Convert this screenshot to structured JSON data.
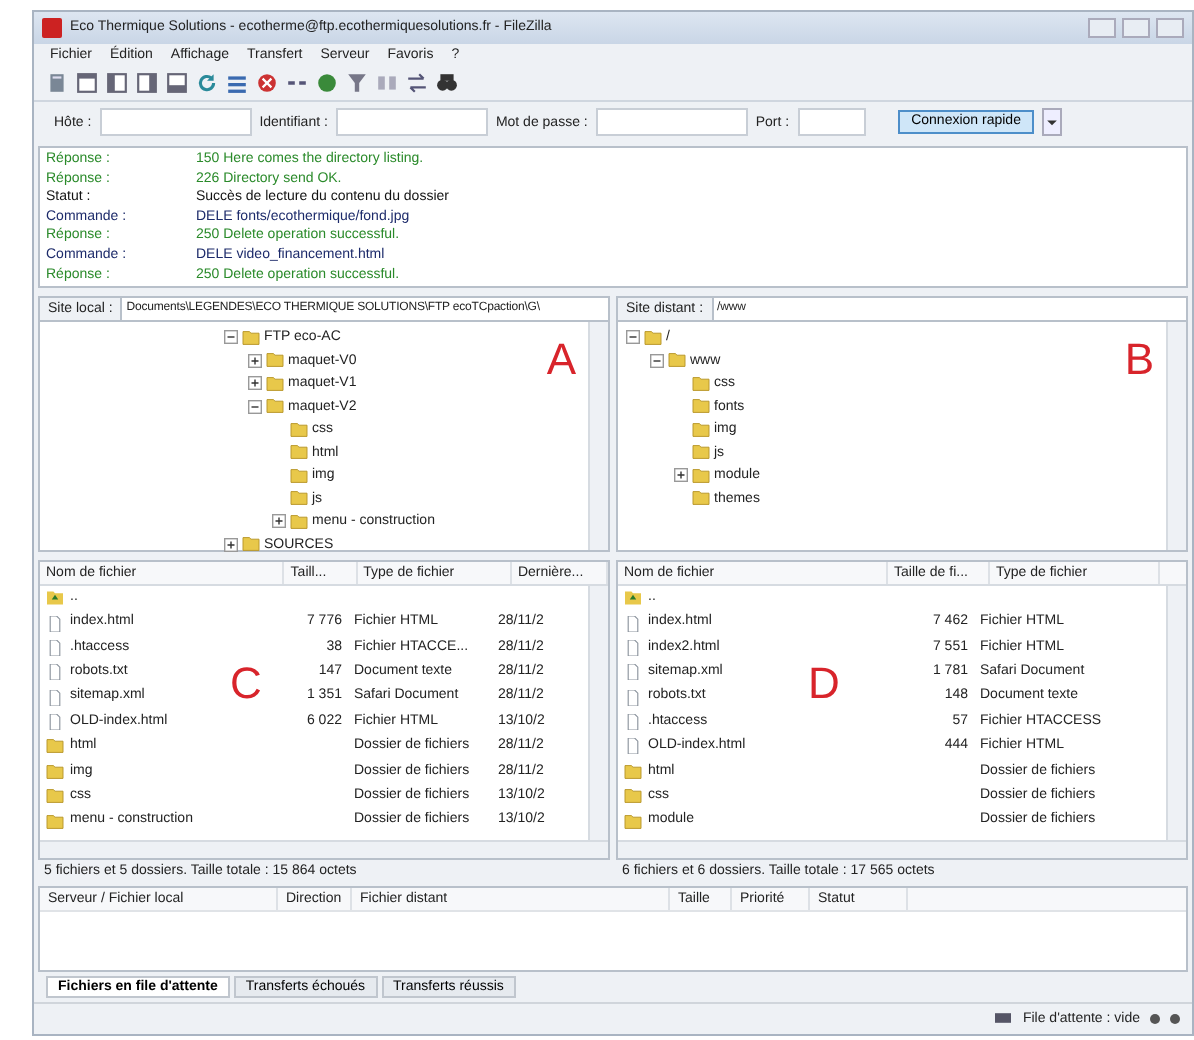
{
  "window": {
    "title": "Eco Thermique Solutions - ecotherme@ftp.ecothermiquesolutions.fr - FileZilla"
  },
  "menu": [
    "Fichier",
    "Édition",
    "Affichage",
    "Transfert",
    "Serveur",
    "Favoris",
    "?"
  ],
  "quickconnect": {
    "fields": [
      {
        "label": "Hôte :"
      },
      {
        "label": "Identifiant :"
      },
      {
        "label": "Mot de passe :"
      },
      {
        "label": "Port :"
      }
    ],
    "button": "Connexion rapide"
  },
  "log": [
    {
      "kind": "reponse",
      "label": "Réponse :",
      "text": "150 Here comes the directory listing."
    },
    {
      "kind": "reponse",
      "label": "Réponse :",
      "text": "226 Directory send OK."
    },
    {
      "kind": "statut",
      "label": "Statut :",
      "text": "Succès de lecture du contenu du dossier"
    },
    {
      "kind": "commande",
      "label": "Commande :",
      "text": "DELE fonts/ecothermique/fond.jpg"
    },
    {
      "kind": "reponse",
      "label": "Réponse :",
      "text": "250 Delete operation successful."
    },
    {
      "kind": "commande",
      "label": "Commande :",
      "text": "DELE video_financement.html"
    },
    {
      "kind": "reponse",
      "label": "Réponse :",
      "text": "250 Delete operation successful."
    }
  ],
  "local": {
    "site_label": "Site local :",
    "path": "Documents\\LEGENDES\\ECO THERMIQUE SOLUTIONS\\FTP ecoTCpaction\\G\\",
    "annotation": "A",
    "tree": [
      {
        "name": "FTP eco-AC",
        "children": [
          {
            "name": "maquet-V0",
            "collapsed": true
          },
          {
            "name": "maquet-V1",
            "collapsed": true
          },
          {
            "name": "maquet-V2",
            "children": [
              {
                "name": "css"
              },
              {
                "name": "html"
              },
              {
                "name": "img"
              },
              {
                "name": "js"
              },
              {
                "name": "menu - construction",
                "collapsed": true
              }
            ]
          }
        ]
      },
      {
        "name": "SOURCES",
        "collapsed": true
      }
    ],
    "list_annotation": "C",
    "columns": [
      "Nom de fichier",
      "Taill...",
      "Type de fichier",
      "Dernière..."
    ],
    "rows": [
      {
        "kind": "parent",
        "cells": [
          ".."
        ]
      },
      {
        "kind": "file",
        "cells": [
          "index.html",
          "7 776",
          "Fichier HTML",
          "28/11/2"
        ]
      },
      {
        "kind": "file",
        "cells": [
          ".htaccess",
          "38",
          "Fichier HTACCE...",
          "28/11/2"
        ]
      },
      {
        "kind": "file",
        "cells": [
          "robots.txt",
          "147",
          "Document texte",
          "28/11/2"
        ]
      },
      {
        "kind": "file",
        "cells": [
          "sitemap.xml",
          "1 351",
          "Safari Document",
          "28/11/2"
        ]
      },
      {
        "kind": "file",
        "cells": [
          "OLD-index.html",
          "6 022",
          "Fichier HTML",
          "13/10/2"
        ]
      },
      {
        "kind": "folder",
        "cells": [
          "html",
          "",
          "Dossier de fichiers",
          "28/11/2"
        ]
      },
      {
        "kind": "folder",
        "cells": [
          "img",
          "",
          "Dossier de fichiers",
          "28/11/2"
        ]
      },
      {
        "kind": "folder",
        "cells": [
          "css",
          "",
          "Dossier de fichiers",
          "13/10/2"
        ]
      },
      {
        "kind": "folder",
        "cells": [
          "menu - construction",
          "",
          "Dossier de fichiers",
          "13/10/2"
        ]
      }
    ],
    "status": "5 fichiers et 5 dossiers. Taille totale : 15 864 octets"
  },
  "remote": {
    "site_label": "Site distant :",
    "path": "/www",
    "annotation": "B",
    "tree": [
      {
        "name": "/",
        "children": [
          {
            "name": "www",
            "children": [
              {
                "name": "css"
              },
              {
                "name": "fonts"
              },
              {
                "name": "img"
              },
              {
                "name": "js"
              },
              {
                "name": "module",
                "collapsed": true
              },
              {
                "name": "themes"
              }
            ]
          }
        ]
      }
    ],
    "list_annotation": "D",
    "columns": [
      "Nom de fichier",
      "Taille de fi...",
      "Type de fichier"
    ],
    "rows": [
      {
        "kind": "parent",
        "cells": [
          ".."
        ]
      },
      {
        "kind": "file",
        "cells": [
          "index.html",
          "7 462",
          "Fichier HTML"
        ]
      },
      {
        "kind": "file",
        "cells": [
          "index2.html",
          "7 551",
          "Fichier HTML"
        ]
      },
      {
        "kind": "file",
        "cells": [
          "sitemap.xml",
          "1 781",
          "Safari Document"
        ]
      },
      {
        "kind": "file",
        "cells": [
          "robots.txt",
          "148",
          "Document texte"
        ]
      },
      {
        "kind": "file",
        "cells": [
          ".htaccess",
          "57",
          "Fichier HTACCESS"
        ]
      },
      {
        "kind": "file",
        "cells": [
          "OLD-index.html",
          "444",
          "Fichier HTML"
        ]
      },
      {
        "kind": "folder",
        "cells": [
          "html",
          "",
          "Dossier de fichiers"
        ]
      },
      {
        "kind": "folder",
        "cells": [
          "css",
          "",
          "Dossier de fichiers"
        ]
      },
      {
        "kind": "folder",
        "cells": [
          "module",
          "",
          "Dossier de fichiers"
        ]
      }
    ],
    "status": "6 fichiers et 6 dossiers. Taille totale : 17 565 octets"
  },
  "queue": {
    "columns": [
      "Serveur / Fichier local",
      "Direction",
      "Fichier distant",
      "Taille",
      "Priorité",
      "Statut"
    ],
    "tabs": [
      {
        "label": "Fichiers en file d'attente",
        "selected": true
      },
      {
        "label": "Transferts échoués",
        "selected": false
      },
      {
        "label": "Transferts réussis",
        "selected": false
      }
    ]
  },
  "status_bar": {
    "queue": "File d'attente : vide"
  }
}
